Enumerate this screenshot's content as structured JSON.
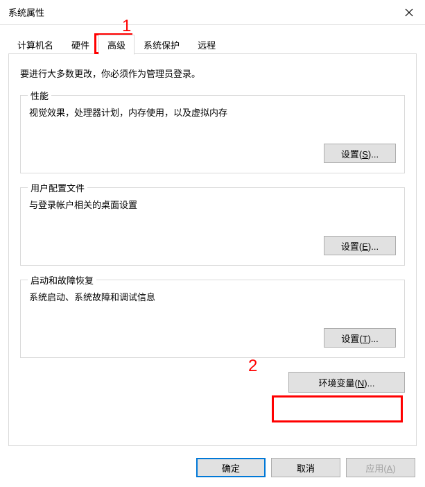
{
  "window": {
    "title": "系统属性"
  },
  "tabs": {
    "computer_name": "计算机名",
    "hardware": "硬件",
    "advanced": "高级",
    "system_protection": "系统保护",
    "remote": "远程"
  },
  "intro": "要进行大多数更改，你必须作为管理员登录。",
  "groups": {
    "performance": {
      "legend": "性能",
      "desc": "视觉效果，处理器计划，内存使用，以及虚拟内存",
      "button_prefix": "设置(",
      "button_key": "S",
      "button_suffix": ")..."
    },
    "user_profiles": {
      "legend": "用户配置文件",
      "desc": "与登录帐户相关的桌面设置",
      "button_prefix": "设置(",
      "button_key": "E",
      "button_suffix": ")..."
    },
    "startup_recovery": {
      "legend": "启动和故障恢复",
      "desc": "系统启动、系统故障和调试信息",
      "button_prefix": "设置(",
      "button_key": "T",
      "button_suffix": ")..."
    }
  },
  "env_button": {
    "prefix": "环境变量(",
    "key": "N",
    "suffix": ")..."
  },
  "bottom": {
    "ok": "确定",
    "cancel": "取消",
    "apply_prefix": "应用(",
    "apply_key": "A",
    "apply_suffix": ")"
  },
  "annotations": {
    "one": "1",
    "two": "2"
  }
}
